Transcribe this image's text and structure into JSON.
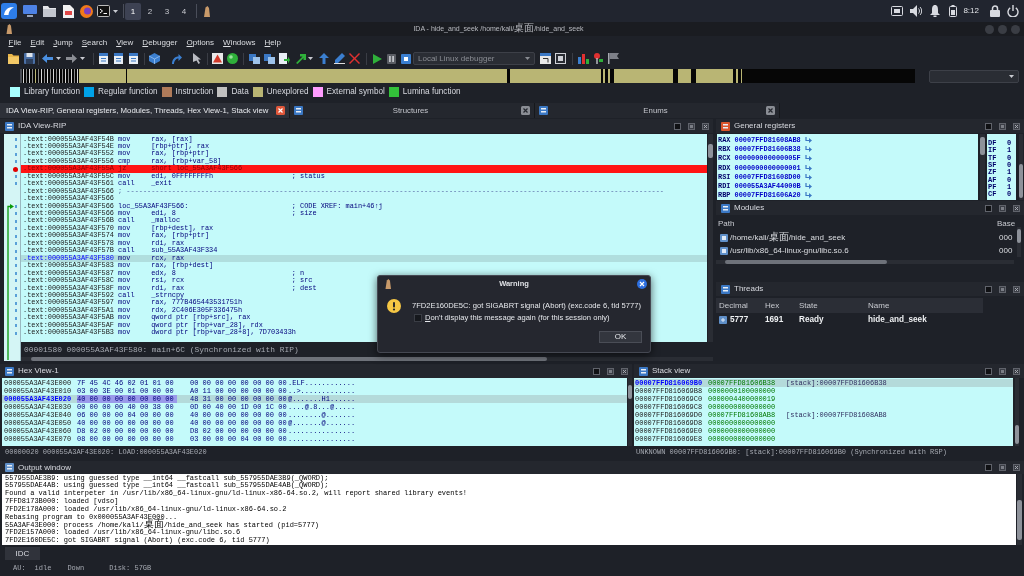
{
  "taskbar": {
    "workspaces": [
      {
        "label": "1",
        "selected": true
      },
      {
        "label": "2",
        "selected": false
      },
      {
        "label": "3",
        "selected": false
      },
      {
        "label": "4",
        "selected": false
      }
    ],
    "clock": "8:12"
  },
  "window": {
    "title": "IDA - hide_and_seek /home/kali/桌面/hide_and_seek"
  },
  "menu": [
    "File",
    "Edit",
    "Jump",
    "Search",
    "View",
    "Debugger",
    "Options",
    "Windows",
    "Help"
  ],
  "toolbar": {
    "debugger": "Local Linux debugger"
  },
  "legend": [
    {
      "label": "Library function",
      "color": "#a8ffff"
    },
    {
      "label": "Regular function",
      "color": "#00a2e8"
    },
    {
      "label": "Instruction",
      "color": "#b07b5a"
    },
    {
      "label": "Data",
      "color": "#c0c0c0"
    },
    {
      "label": "Unexplored",
      "color": "#b9b574"
    },
    {
      "label": "External symbol",
      "color": "#ff9cff"
    },
    {
      "label": "Lumina function",
      "color": "#33c03a"
    }
  ],
  "tabs": [
    {
      "label": "IDA View-RIP, General registers, Modules, Threads, Hex View-1, Stack view",
      "selected": true
    },
    {
      "label": "Structures",
      "selected": false
    },
    {
      "label": "Enums",
      "selected": false
    }
  ],
  "ida_view": {
    "title": "IDA View-RIP",
    "lines": [
      {
        "kind": "instr",
        "address": ".text:000055A3AF43F54B",
        "mnemonic": "mov",
        "operands": "rax, [rax]",
        "breakpoint": false,
        "current": false
      },
      {
        "kind": "instr",
        "address": ".text:000055A3AF43F54E",
        "mnemonic": "mov",
        "operands": "[rbp+ptr], rax",
        "breakpoint": false,
        "current": false
      },
      {
        "kind": "instr",
        "address": ".text:000055A3AF43F552",
        "mnemonic": "mov",
        "operands": "rax, [rbp+ptr]",
        "breakpoint": false,
        "current": false
      },
      {
        "kind": "instr",
        "address": ".text:000055A3AF43F556",
        "mnemonic": "cmp",
        "operands": "rax, [rbp+var_58]",
        "breakpoint": false,
        "current": false
      },
      {
        "kind": "instr",
        "address": ".text:000055A3AF43F55A",
        "mnemonic": "jz",
        "operands": "short loc_55A3AF43F566",
        "breakpoint": true,
        "current": false
      },
      {
        "kind": "instr",
        "address": ".text:000055A3AF43F55C",
        "mnemonic": "mov",
        "operands": "edi, 0FFFFFFFFh",
        "comment": "; status",
        "breakpoint": false,
        "current": false
      },
      {
        "kind": "instr",
        "address": ".text:000055A3AF43F561",
        "mnemonic": "call",
        "operands": "_exit",
        "breakpoint": false,
        "current": false
      },
      {
        "kind": "separator",
        "address": ".text:000055A3AF43F566",
        "text": "; ----------------------------------------------------------------------------------------------------------------------------------",
        "breakpoint": false,
        "current": false
      },
      {
        "kind": "blank",
        "address": ".text:000055A3AF43F566",
        "breakpoint": false,
        "current": false
      },
      {
        "kind": "label",
        "address": ".text:000055A3AF43F566",
        "label": "loc_55A3AF43F566:",
        "comment": "; CODE XREF: main+46↑j",
        "breakpoint": false,
        "current": false
      },
      {
        "kind": "instr",
        "address": ".text:000055A3AF43F566",
        "mnemonic": "mov",
        "operands": "edi, 8",
        "comment": "; size",
        "breakpoint": false,
        "current": false
      },
      {
        "kind": "instr",
        "address": ".text:000055A3AF43F56B",
        "mnemonic": "call",
        "operands": "_malloc",
        "breakpoint": false,
        "current": false
      },
      {
        "kind": "instr",
        "address": ".text:000055A3AF43F570",
        "mnemonic": "mov",
        "operands": "[rbp+dest], rax",
        "breakpoint": false,
        "current": false
      },
      {
        "kind": "instr",
        "address": ".text:000055A3AF43F574",
        "mnemonic": "mov",
        "operands": "rax, [rbp+ptr]",
        "breakpoint": false,
        "current": false
      },
      {
        "kind": "instr",
        "address": ".text:000055A3AF43F578",
        "mnemonic": "mov",
        "operands": "rdi, rax",
        "breakpoint": false,
        "current": false
      },
      {
        "kind": "instr",
        "address": ".text:000055A3AF43F57B",
        "mnemonic": "call",
        "operands": "sub_55A3AF43F334",
        "breakpoint": false,
        "current": false
      },
      {
        "kind": "instr",
        "address": ".text:000055A3AF43F580",
        "mnemonic": "mov",
        "operands": "rcx, rax",
        "breakpoint": false,
        "current": true
      },
      {
        "kind": "instr",
        "address": ".text:000055A3AF43F583",
        "mnemonic": "mov",
        "operands": "rax, [rbp+dest]",
        "breakpoint": false,
        "current": false
      },
      {
        "kind": "instr",
        "address": ".text:000055A3AF43F587",
        "mnemonic": "mov",
        "operands": "edx, 8",
        "comment": "; n",
        "breakpoint": false,
        "current": false
      },
      {
        "kind": "instr",
        "address": ".text:000055A3AF43F58C",
        "mnemonic": "mov",
        "operands": "rsi, rcx",
        "comment": "; src",
        "breakpoint": false,
        "current": false
      },
      {
        "kind": "instr",
        "address": ".text:000055A3AF43F58F",
        "mnemonic": "mov",
        "operands": "rdi, rax",
        "comment": "; dest",
        "breakpoint": false,
        "current": false
      },
      {
        "kind": "instr",
        "address": ".text:000055A3AF43F592",
        "mnemonic": "call",
        "operands": "_strncpy",
        "breakpoint": false,
        "current": false
      },
      {
        "kind": "instr",
        "address": ".text:000055A3AF43F597",
        "mnemonic": "mov",
        "operands": "rax, 777B465443531751h",
        "breakpoint": false,
        "current": false
      },
      {
        "kind": "instr",
        "address": ".text:000055A3AF43F5A1",
        "mnemonic": "mov",
        "operands": "rdx, 2C406E305F336475h",
        "breakpoint": false,
        "current": false
      },
      {
        "kind": "instr",
        "address": ".text:000055A3AF43F5AB",
        "mnemonic": "mov",
        "operands": "qword ptr [rbp+src], rax",
        "breakpoint": false,
        "current": false
      },
      {
        "kind": "instr",
        "address": ".text:000055A3AF43F5AF",
        "mnemonic": "mov",
        "operands": "qword ptr [rbp+var_28], rdx",
        "breakpoint": false,
        "current": false
      },
      {
        "kind": "instr",
        "address": ".text:000055A3AF43F5B3",
        "mnemonic": "mov",
        "operands": "dword ptr [rbp+var_28+8], 7D703433h",
        "breakpoint": false,
        "current": false
      }
    ],
    "status": "00001580 000055A3AF43F580: main+6C (Synchronized with RIP)"
  },
  "registers": {
    "title": "General registers",
    "rows": [
      {
        "name": "RAX",
        "value": "00007FFD81608AB8"
      },
      {
        "name": "RBX",
        "value": "00007FFD81606B38"
      },
      {
        "name": "RCX",
        "value": "000000000000005F"
      },
      {
        "name": "RDX",
        "value": "0000000000000001"
      },
      {
        "name": "RSI",
        "value": "00007FFD81608D00"
      },
      {
        "name": "RDI",
        "value": "000055A3AF44000B"
      },
      {
        "name": "RBP",
        "value": "00007FFD81606A20"
      }
    ],
    "flags": [
      {
        "name": "DF",
        "value": "0"
      },
      {
        "name": "IF",
        "value": "1"
      },
      {
        "name": "TF",
        "value": "0"
      },
      {
        "name": "SF",
        "value": "0"
      },
      {
        "name": "ZF",
        "value": "1"
      },
      {
        "name": "AF",
        "value": "0"
      },
      {
        "name": "PF",
        "value": "1"
      },
      {
        "name": "CF",
        "value": "0"
      }
    ]
  },
  "modules": {
    "title": "Modules",
    "columns": [
      "Path",
      "Base"
    ],
    "rows": [
      {
        "path": "/home/kali/桌面/hide_and_seek",
        "base": "000"
      },
      {
        "path": "/usr/lib/x86_64-linux-gnu/libc.so.6",
        "base": "000"
      }
    ]
  },
  "threads": {
    "title": "Threads",
    "columns": [
      "Decimal",
      "Hex",
      "State",
      "Name"
    ],
    "rows": [
      [
        "5777",
        "1691",
        "Ready",
        "hide_and_seek"
      ]
    ]
  },
  "hex_view": {
    "title": "Hex View-1",
    "rows": [
      {
        "address": "000055A3AF43E000",
        "group_1": "7F 45 4C 46 02 01 01 00",
        "group_2": "00 00 00 00 00 00 00 00",
        "ascii": ".ELF............",
        "selected": false
      },
      {
        "address": "000055A3AF43E010",
        "group_1": "03 00 3E 00 01 00 00 00",
        "group_2": "A0 11 00 00 00 00 00 00",
        "ascii": "..>.............",
        "selected": false
      },
      {
        "address": "000055A3AF43E020",
        "group_1": "40 00 00 00 00 00 00 00",
        "group_2": "48 31 00 00 00 00 00 00",
        "ascii": "@.......H1......",
        "selected": true
      },
      {
        "address": "000055A3AF43E030",
        "group_1": "00 00 00 00 40 00 38 00",
        "group_2": "0D 00 40 00 1D 00 1C 00",
        "ascii": "....@.8...@.....",
        "selected": false
      },
      {
        "address": "000055A3AF43E040",
        "group_1": "06 00 00 00 04 00 00 00",
        "group_2": "40 00 00 00 00 00 00 00",
        "ascii": "........@.......",
        "selected": false
      },
      {
        "address": "000055A3AF43E050",
        "group_1": "40 00 00 00 00 00 00 00",
        "group_2": "40 00 00 00 00 00 00 00",
        "ascii": "@.......@.......",
        "selected": false
      },
      {
        "address": "000055A3AF43E060",
        "group_1": "D8 02 00 00 00 00 00 00",
        "group_2": "D8 02 00 00 00 00 00 00",
        "ascii": "................",
        "selected": false
      },
      {
        "address": "000055A3AF43E070",
        "group_1": "08 00 00 00 00 00 00 00",
        "group_2": "03 00 00 00 04 00 00 00",
        "ascii": "................",
        "selected": false
      }
    ],
    "status": "00000020 000055A3AF43E020: LOAD:000055A3AF43E020"
  },
  "stack_view": {
    "title": "Stack view",
    "rows": [
      {
        "address": "00007FFD816069B0",
        "value": "00007FFD81606B38",
        "comment": "[stack]:00007FFD81606B38",
        "selected": true
      },
      {
        "address": "00007FFD816069B8",
        "value": "0000000100000000",
        "selected": false
      },
      {
        "address": "00007FFD816069C0",
        "value": "0000004400000019",
        "selected": false
      },
      {
        "address": "00007FFD816069C8",
        "value": "0000000000000000",
        "selected": false
      },
      {
        "address": "00007FFD816069D0",
        "value": "00007FFD81608AB8",
        "comment": "[stack]:00007FFD81608AB8",
        "selected": false
      },
      {
        "address": "00007FFD816069D8",
        "value": "0000000000000000",
        "selected": false
      },
      {
        "address": "00007FFD816069E0",
        "value": "0000000000000000",
        "selected": false
      },
      {
        "address": "00007FFD816069E8",
        "value": "0000000000000000",
        "selected": false
      }
    ],
    "status": "UNKNOWN 00007FFD816069B0: [stack]:00007FFD816069B0 (Synchronized with RSP)"
  },
  "output": {
    "title": "Output window",
    "lines": [
      "557955DAE3B9: using guessed type __int64 __fastcall sub_557955DAE3B9(_QWORD);",
      "557955DAE4AB: using guessed type __int64 __fastcall sub_557955DAE4AB(_QWORD);",
      "Found a valid interpeter in /usr/lib/x86_64-linux-gnu/ld-linux-x86-64.so.2, will report shared library events!",
      "7FFD8173B000: loaded [vdso]",
      "7FD2E178A000: loaded /usr/lib/x86_64-linux-gnu/ld-linux-x86-64.so.2",
      "Rebasing program to 0x000055A3AF43E000...",
      "55A3AF43E000: process /home/kali/桌面/hide_and_seek has started (pid=5777)",
      "7FD2E157A000: loaded /usr/lib/x86_64-linux-gnu/libc.so.6",
      "7FD2E160DE5C: got SIGABRT signal (Abort) (exc.code 6, tid 5777)"
    ]
  },
  "idc_button": "IDC",
  "status_bar": [
    "AU:",
    "idle",
    "Down",
    "Disk: 57GB"
  ],
  "dialog": {
    "title": "Warning",
    "message": "7FD2E160DE5C: got SIGABRT signal (Abort) (exc.code 6, tid 5777)",
    "checkbox": {
      "label": "Don't display this message again (for this session only)",
      "checked": false
    },
    "button": "OK"
  }
}
